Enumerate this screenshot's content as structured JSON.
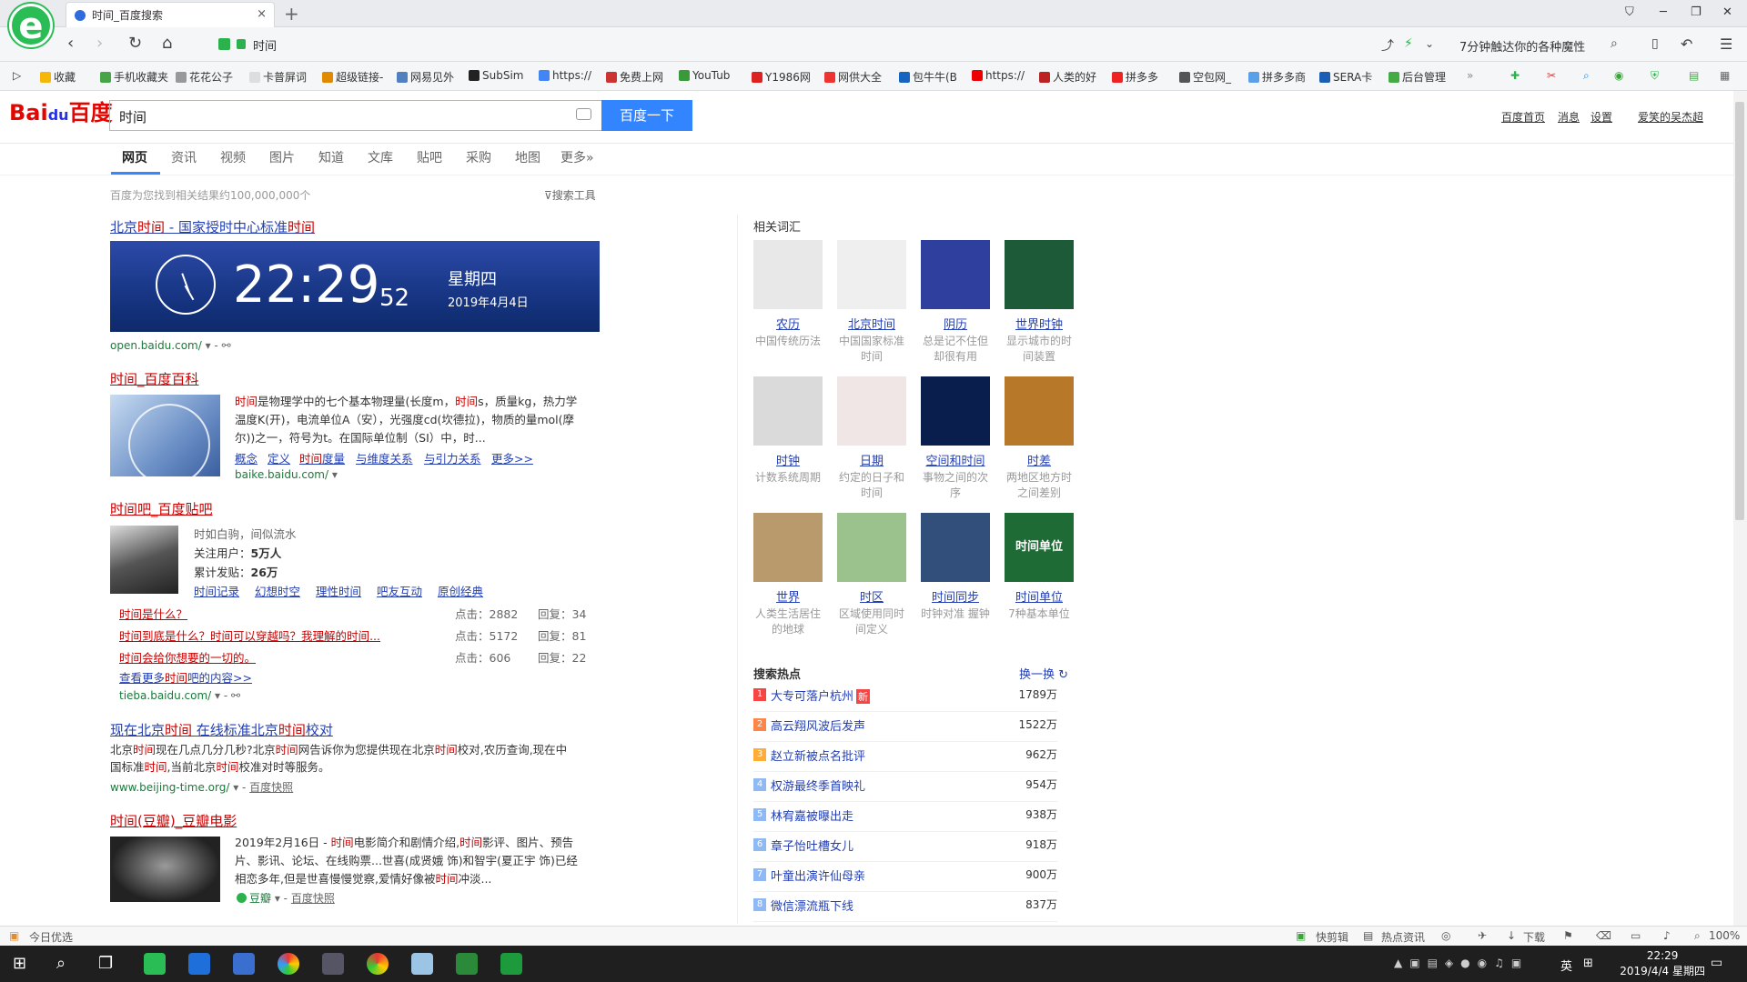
{
  "browser": {
    "logo": "e",
    "tab_title": "时间_百度搜索",
    "tab_close": "×",
    "new_tab": "+",
    "address": "时间",
    "tip_text": "7分钟触达你的各种魔性",
    "bookmarks": [
      "收藏",
      "手机收藏夹",
      "花花公子",
      "卡普屏词",
      "超级链接-",
      "网易见外",
      "SubSim",
      "https://",
      "免费上网",
      "YouTub",
      "Y1986网",
      "网供大全",
      "包牛牛(B",
      "https://",
      "人类的好",
      "拼多多",
      "空包网_",
      "拼多多商",
      "SERA卡",
      "后台管理"
    ]
  },
  "baidu": {
    "logo_left": "Bai",
    "logo_mid": "du",
    "logo_right": "百度",
    "query": "时间",
    "search_button": "百度一下",
    "user_nav": [
      "百度首页",
      "消息",
      "设置",
      "爱笑的吴杰超"
    ],
    "tabs": [
      "网页",
      "资讯",
      "视频",
      "图片",
      "知道",
      "文库",
      "贴吧",
      "采购",
      "地图",
      "更多»"
    ],
    "result_count": "百度为您找到相关结果约100,000,000个",
    "search_tools": "搜索工具"
  },
  "results": {
    "r1": {
      "title_pre": "北京",
      "title_em": "时间",
      "title_mid": " - 国家授时中心标准",
      "title_end": "时间",
      "url": "open.baidu.com/",
      "clock_time": "22:29",
      "clock_sec": "52",
      "clock_weekday": "星期四",
      "clock_date": "2019年4月4日"
    },
    "r2": {
      "title": "时间_百度百科",
      "line1": "时间是物理学中的七个基本物理量(长度m，时间s，质量kg，热力学",
      "line2": "温度K(开)，电流单位A（安），光强度cd(坎德拉)，物质的量mol(摩",
      "line3": "尔))之一，符号为t。在国际单位制（SI）中，时...",
      "links": [
        "概念",
        "定义",
        "时间度量",
        "与维度关系",
        "与引力关系",
        "更多>>"
      ],
      "url": "baike.baidu.com/"
    },
    "r3": {
      "title": "时间吧_百度贴吧",
      "slogan": "时如白驹，间似流水",
      "followers_label": "关注用户：",
      "followers": "5万人",
      "posts_label": "累计发贴：",
      "posts": "26万",
      "links": [
        "时间记录",
        "幻想时空",
        "理性时间",
        "吧友互动",
        "原创经典"
      ],
      "threads": [
        {
          "title": "时间是什么？",
          "clicks": "点击：2882",
          "replies": "回复：34"
        },
        {
          "title": "时间到底是什么？时间可以穿越吗？我理解的时间...",
          "clicks": "点击：5172",
          "replies": "回复：81"
        },
        {
          "title": "时间会给你想要的一切的。",
          "clicks": "点击：606",
          "replies": "回复：22"
        }
      ],
      "more": "查看更多时间吧的内容>>",
      "url": "tieba.baidu.com/"
    },
    "r4": {
      "title": "现在北京时间 在线标准北京时间校对",
      "line1": "北京时间现在几点几分几秒?北京时间网告诉你为您提供现在北京时间校对,农历查询,现在中",
      "line2": "国标准时间,当前北京时间校准对时等服务。",
      "url": "www.beijing-time.org/",
      "snapshot": "百度快照"
    },
    "r5": {
      "title": "时间(豆瓣)_豆瓣电影",
      "line1": "2019年2月16日 - 时间电影简介和剧情介绍,时间影评、图片、预告",
      "line2": "片、影讯、论坛、在线购票...世喜(成贤娥 饰)和智宇(夏正宇 饰)已经",
      "line3": "相恋多年,但是世喜慢慢觉察,爱情好像被时间冲淡...",
      "url": "豆瓣",
      "snapshot": "百度快照"
    }
  },
  "related": {
    "title": "相关词汇",
    "items": [
      {
        "name": "农历",
        "desc": "中国传统历法",
        "color": "#e8e8e8"
      },
      {
        "name": "北京时间",
        "desc": "中国国家标准时间",
        "color": "#efefef"
      },
      {
        "name": "阴历",
        "desc": "总是记不住但却很有用",
        "color": "#2f3f9e"
      },
      {
        "name": "世界时钟",
        "desc": "显示城市的时间装置",
        "color": "#1d5a37"
      },
      {
        "name": "时钟",
        "desc": "计数系统周期",
        "color": "#dadada"
      },
      {
        "name": "日期",
        "desc": "约定的日子和时间",
        "color": "#f1e6e6"
      },
      {
        "name": "空间和时间",
        "desc": "事物之间的次序",
        "color": "#0a1e4e"
      },
      {
        "name": "时差",
        "desc": "两地区地方时之间差别",
        "color": "#b7782a"
      },
      {
        "name": "世界",
        "desc": "人类生活居住的地球",
        "color": "#b99a6c"
      },
      {
        "name": "时区",
        "desc": "区域使用同时间定义",
        "color": "#9bc28c"
      },
      {
        "name": "时间同步",
        "desc": "时钟对准 握钟",
        "color": "#324e7a"
      },
      {
        "name": "时间单位",
        "desc": "7种基本单位",
        "color": "#1f6b35"
      }
    ],
    "tile_text": "时间单位"
  },
  "hot": {
    "title": "搜索热点",
    "refresh": "换一换",
    "new_badge": "新",
    "items": [
      {
        "n": "1",
        "t": "大专可落户杭州",
        "c": "1789万"
      },
      {
        "n": "2",
        "t": "高云翔风波后发声",
        "c": "1522万"
      },
      {
        "n": "3",
        "t": "赵立新被点名批评",
        "c": "962万"
      },
      {
        "n": "4",
        "t": "权游最终季首映礼",
        "c": "954万"
      },
      {
        "n": "5",
        "t": "林宥嘉被曝出走",
        "c": "938万"
      },
      {
        "n": "6",
        "t": "章子怡吐槽女儿",
        "c": "918万"
      },
      {
        "n": "7",
        "t": "叶童出演许仙母亲",
        "c": "900万"
      },
      {
        "n": "8",
        "t": "微信漂流瓶下线",
        "c": "837万"
      }
    ]
  },
  "statusbar": {
    "left": "今日优选",
    "items": [
      "快剪辑",
      "热点资讯",
      "下载",
      "100%"
    ]
  },
  "taskbar": {
    "time": "22:29",
    "date": "2019/4/4 星期四",
    "lang": "英"
  },
  "colors": {
    "baidu_blue": "#3385ff",
    "link": "#2440b3",
    "em": "#cc0000",
    "url_green": "#1a7a3a"
  }
}
